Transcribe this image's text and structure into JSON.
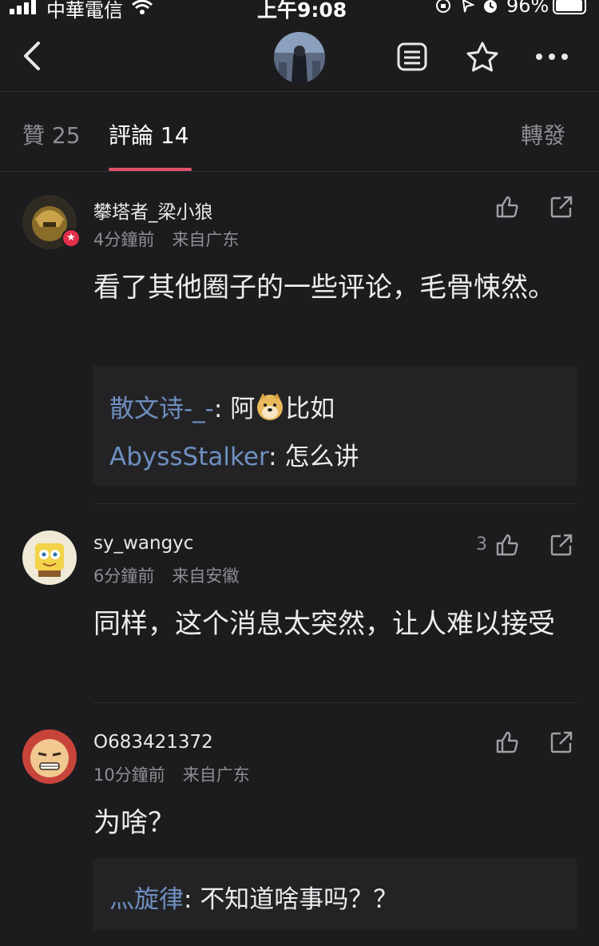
{
  "status": {
    "carrier": "中華電信",
    "time": "上午9:08",
    "battery": "96%"
  },
  "tabs": {
    "likes": "贊 25",
    "comments": "評論 14",
    "shares": "轉發"
  },
  "comments": [
    {
      "username": "攀塔者_梁小狼",
      "time": "4分鐘前",
      "location": "来自广东",
      "text": "看了其他圈子的一些评论，毛骨悚然。",
      "likes": "",
      "replies": [
        {
          "user": "散文诗-_-",
          "sep": ": ",
          "text_a": "阿",
          "text_b": "比如"
        },
        {
          "user": "AbyssStalker",
          "sep": ": ",
          "text": "怎么讲"
        }
      ]
    },
    {
      "username": "sy_wangyc",
      "time": "6分鐘前",
      "location": "来自安徽",
      "text": "同样，这个消息太突然，让人难以接受",
      "likes": "3"
    },
    {
      "username": "O683421372",
      "time": "10分鐘前",
      "location": "来自广东",
      "text": "为啥？",
      "likes": "",
      "replies": [
        {
          "user": "灬旋律",
          "sep": ": ",
          "text": "不知道啥事吗？？"
        }
      ]
    }
  ],
  "colors": {
    "background": "#1c1c1e",
    "accent": "#e0526a",
    "reply_user": "#6e8fc0"
  }
}
